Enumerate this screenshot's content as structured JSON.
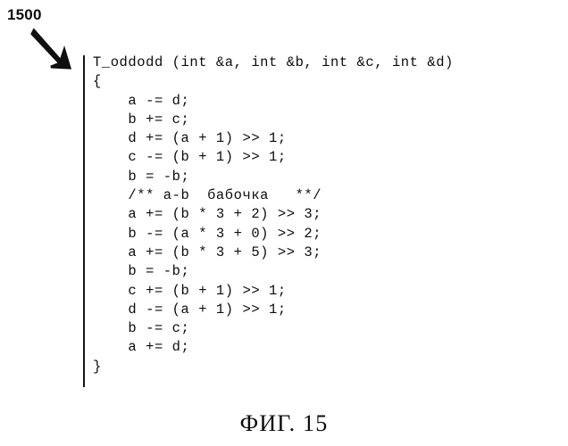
{
  "figure": {
    "reference_number": "1500",
    "caption": "ФИГ. 15",
    "arrow_icon": "arrow-down-right-icon",
    "ink_color": "#0d0d0d",
    "background_color": "#ffffff"
  },
  "code_listing": {
    "language": "c",
    "function_name": "T_oddodd",
    "lines": [
      "T_oddodd (int &a, int &b, int &c, int &d)",
      "{",
      "    a -= d;",
      "    b += c;",
      "    d += (a + 1) >> 1;",
      "    c -= (b + 1) >> 1;",
      "    b = -b;",
      "    /** a-b  бабочка   **/",
      "    a += (b * 3 + 2) >> 3;",
      "    b -= (a * 3 + 0) >> 2;",
      "    a += (b * 3 + 5) >> 3;",
      "    b = -b;",
      "    c += (b + 1) >> 1;",
      "    d -= (a + 1) >> 1;",
      "    b -= c;",
      "    a += d;",
      "}"
    ]
  }
}
